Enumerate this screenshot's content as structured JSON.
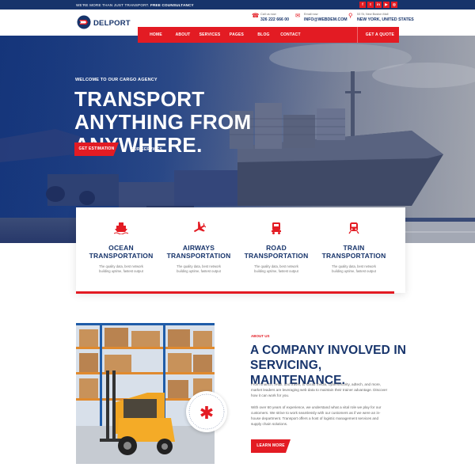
{
  "topbar": {
    "message": "WE'RE MORE THAN JUST TRANSPORT.",
    "message_bold": "FREE COUNSULTANCY",
    "socials": [
      "f",
      "t",
      "in",
      "▶",
      "◎"
    ]
  },
  "header": {
    "brand": "DELPORT",
    "contacts": [
      {
        "label": "Call us now",
        "value": "326 222 666 00",
        "icon": "phone-icon"
      },
      {
        "label": "Email now",
        "value": "INFO@WEBDEM.COM",
        "icon": "mail-icon"
      },
      {
        "label": "53 St, New Boston Mall",
        "value": "NEW YORK, UNITED STATES",
        "icon": "location-icon"
      }
    ]
  },
  "nav": {
    "items": [
      "HOME",
      "ABOUT",
      "SERVICES",
      "PAGES",
      "BLOG",
      "CONTACT"
    ],
    "cta": "GET A QUOTE"
  },
  "hero": {
    "welcome": "WELCOME TO OUR CARGO AGENCY",
    "title": "TRANSPORT ANYTHING FROM ANYWHERE.",
    "primary_button": "GET ESTIMATION",
    "secondary_button": "OUR SERVICES"
  },
  "services": [
    {
      "icon": "ship-icon",
      "name": "OCEAN TRANSPORTATION",
      "desc": "The quality data, best network building uptime, fastest output"
    },
    {
      "icon": "airplane-icon",
      "name": "AIRWAYS TRANSPORTATION",
      "desc": "The quality data, best network building uptime, fastest output"
    },
    {
      "icon": "truck-icon",
      "name": "ROAD TRANSPORTATION",
      "desc": "The quality data, best network building uptime, fastest output"
    },
    {
      "icon": "train-icon",
      "name": "TRAIN TRANSPORTATION",
      "desc": "The quality data, best network building uptime, fastest output"
    }
  ],
  "about": {
    "label": "ABOUT US",
    "title": "A COMPANY INVOLVED IN SERVICING, MAINTENANCE.",
    "paragraph1": "From finance, retail, and travel, to social media, cybersecurity, adtech, and more, market leaders are leveraging web data to maintain their trainer advantage. Discover how it can work for you.",
    "paragraph2": "With over 60 years of experience, we understand what a vital role we play for our customers. We strive to work seamlessly with our customers as if we were an in-house department. Transport offers a host of logistic management services and supply chain solutions.",
    "button": "LEARN MORE",
    "badge_since": "SINCE - 2000",
    "badge_ring": "WELCOME TO OUR CARGO SERVICES"
  },
  "colors": {
    "primary": "#17346b",
    "accent": "#e31b23"
  }
}
